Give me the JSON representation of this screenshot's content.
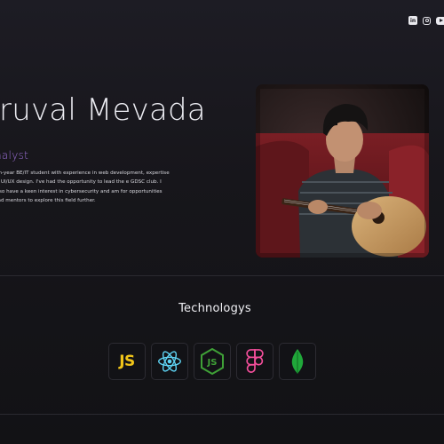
{
  "hero": {
    "name": "aruval Mevada",
    "role": "nalyst",
    "bio": "rth-year BE/IT student with experience in web development, expertise in UI/UX design. I've had the opportunity to lead the e GDSC club. I also have a keen interest in cybersecurity and am for opportunities and mentors to explore this field further."
  },
  "social": [
    {
      "name": "linkedin-icon",
      "glyph": "in"
    },
    {
      "name": "instagram-icon",
      "glyph": ""
    },
    {
      "name": "youtube-icon",
      "glyph": ""
    }
  ],
  "technologies": {
    "title": "Technologys",
    "items": [
      {
        "name": "javascript-icon",
        "label": "JS",
        "color": "#f0c419"
      },
      {
        "name": "react-icon",
        "color": "#5ed3f3"
      },
      {
        "name": "nodejs-icon",
        "color": "#3fa037"
      },
      {
        "name": "figma-icon",
        "color": "#f24e9a"
      },
      {
        "name": "mongodb-icon",
        "color": "#20a83a"
      }
    ]
  },
  "colors": {
    "background": "#17161b",
    "accent": "#9b6fd6",
    "text": "#ececf2"
  }
}
